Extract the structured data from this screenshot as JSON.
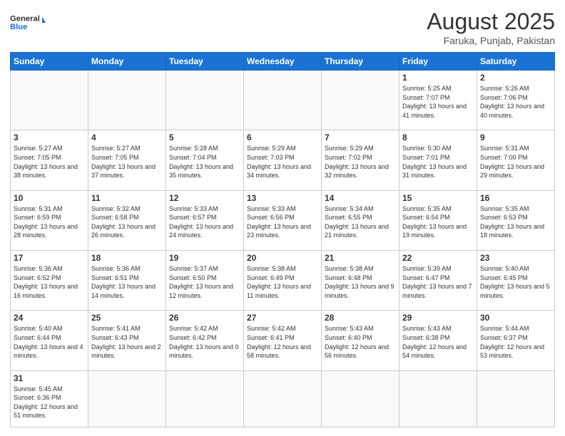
{
  "header": {
    "logo_general": "General",
    "logo_blue": "Blue",
    "month_year": "August 2025",
    "location": "Faruka, Punjab, Pakistan"
  },
  "weekdays": [
    "Sunday",
    "Monday",
    "Tuesday",
    "Wednesday",
    "Thursday",
    "Friday",
    "Saturday"
  ],
  "weeks": [
    [
      {
        "day": "",
        "info": ""
      },
      {
        "day": "",
        "info": ""
      },
      {
        "day": "",
        "info": ""
      },
      {
        "day": "",
        "info": ""
      },
      {
        "day": "",
        "info": ""
      },
      {
        "day": "1",
        "info": "Sunrise: 5:25 AM\nSunset: 7:07 PM\nDaylight: 13 hours and 41 minutes."
      },
      {
        "day": "2",
        "info": "Sunrise: 5:26 AM\nSunset: 7:06 PM\nDaylight: 13 hours and 40 minutes."
      }
    ],
    [
      {
        "day": "3",
        "info": "Sunrise: 5:27 AM\nSunset: 7:05 PM\nDaylight: 13 hours and 38 minutes."
      },
      {
        "day": "4",
        "info": "Sunrise: 5:27 AM\nSunset: 7:05 PM\nDaylight: 13 hours and 37 minutes."
      },
      {
        "day": "5",
        "info": "Sunrise: 5:28 AM\nSunset: 7:04 PM\nDaylight: 13 hours and 35 minutes."
      },
      {
        "day": "6",
        "info": "Sunrise: 5:29 AM\nSunset: 7:03 PM\nDaylight: 13 hours and 34 minutes."
      },
      {
        "day": "7",
        "info": "Sunrise: 5:29 AM\nSunset: 7:02 PM\nDaylight: 13 hours and 32 minutes."
      },
      {
        "day": "8",
        "info": "Sunrise: 5:30 AM\nSunset: 7:01 PM\nDaylight: 13 hours and 31 minutes."
      },
      {
        "day": "9",
        "info": "Sunrise: 5:31 AM\nSunset: 7:00 PM\nDaylight: 13 hours and 29 minutes."
      }
    ],
    [
      {
        "day": "10",
        "info": "Sunrise: 5:31 AM\nSunset: 6:59 PM\nDaylight: 13 hours and 28 minutes."
      },
      {
        "day": "11",
        "info": "Sunrise: 5:32 AM\nSunset: 6:58 PM\nDaylight: 13 hours and 26 minutes."
      },
      {
        "day": "12",
        "info": "Sunrise: 5:33 AM\nSunset: 6:57 PM\nDaylight: 13 hours and 24 minutes."
      },
      {
        "day": "13",
        "info": "Sunrise: 5:33 AM\nSunset: 6:56 PM\nDaylight: 13 hours and 23 minutes."
      },
      {
        "day": "14",
        "info": "Sunrise: 5:34 AM\nSunset: 6:55 PM\nDaylight: 13 hours and 21 minutes."
      },
      {
        "day": "15",
        "info": "Sunrise: 5:35 AM\nSunset: 6:54 PM\nDaylight: 13 hours and 19 minutes."
      },
      {
        "day": "16",
        "info": "Sunrise: 5:35 AM\nSunset: 6:53 PM\nDaylight: 13 hours and 18 minutes."
      }
    ],
    [
      {
        "day": "17",
        "info": "Sunrise: 5:36 AM\nSunset: 6:52 PM\nDaylight: 13 hours and 16 minutes."
      },
      {
        "day": "18",
        "info": "Sunrise: 5:36 AM\nSunset: 6:51 PM\nDaylight: 13 hours and 14 minutes."
      },
      {
        "day": "19",
        "info": "Sunrise: 5:37 AM\nSunset: 6:50 PM\nDaylight: 13 hours and 12 minutes."
      },
      {
        "day": "20",
        "info": "Sunrise: 5:38 AM\nSunset: 6:49 PM\nDaylight: 13 hours and 11 minutes."
      },
      {
        "day": "21",
        "info": "Sunrise: 5:38 AM\nSunset: 6:48 PM\nDaylight: 13 hours and 9 minutes."
      },
      {
        "day": "22",
        "info": "Sunrise: 5:39 AM\nSunset: 6:47 PM\nDaylight: 13 hours and 7 minutes."
      },
      {
        "day": "23",
        "info": "Sunrise: 5:40 AM\nSunset: 6:45 PM\nDaylight: 13 hours and 5 minutes."
      }
    ],
    [
      {
        "day": "24",
        "info": "Sunrise: 5:40 AM\nSunset: 6:44 PM\nDaylight: 13 hours and 4 minutes."
      },
      {
        "day": "25",
        "info": "Sunrise: 5:41 AM\nSunset: 6:43 PM\nDaylight: 13 hours and 2 minutes."
      },
      {
        "day": "26",
        "info": "Sunrise: 5:42 AM\nSunset: 6:42 PM\nDaylight: 13 hours and 0 minutes."
      },
      {
        "day": "27",
        "info": "Sunrise: 5:42 AM\nSunset: 6:41 PM\nDaylight: 12 hours and 58 minutes."
      },
      {
        "day": "28",
        "info": "Sunrise: 5:43 AM\nSunset: 6:40 PM\nDaylight: 12 hours and 56 minutes."
      },
      {
        "day": "29",
        "info": "Sunrise: 5:43 AM\nSunset: 6:38 PM\nDaylight: 12 hours and 54 minutes."
      },
      {
        "day": "30",
        "info": "Sunrise: 5:44 AM\nSunset: 6:37 PM\nDaylight: 12 hours and 53 minutes."
      }
    ],
    [
      {
        "day": "31",
        "info": "Sunrise: 5:45 AM\nSunset: 6:36 PM\nDaylight: 12 hours and 51 minutes."
      },
      {
        "day": "",
        "info": ""
      },
      {
        "day": "",
        "info": ""
      },
      {
        "day": "",
        "info": ""
      },
      {
        "day": "",
        "info": ""
      },
      {
        "day": "",
        "info": ""
      },
      {
        "day": "",
        "info": ""
      }
    ]
  ]
}
